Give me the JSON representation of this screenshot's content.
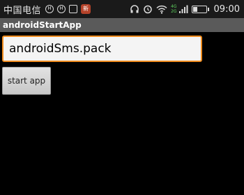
{
  "status_bar": {
    "carrier": "中国电信",
    "icons_left": [
      "hd-icon",
      "hd-icon",
      "image-notification-icon",
      "app-notification-icon"
    ],
    "app_badge_text": "新",
    "icons_right": [
      "headphones-icon",
      "alarm-icon",
      "wifi-icon",
      "signal-icon",
      "sim-icon",
      "battery-icon"
    ],
    "net_4g": "4G",
    "net_2g": "2G",
    "battery_level": 0.35,
    "time": "09:00"
  },
  "action_bar": {
    "title": "androidStartApp"
  },
  "main": {
    "package_input_value": "androidSms.pack",
    "start_button_label": "start app"
  },
  "colors": {
    "input_focus_border": "#f08c1e",
    "action_bar_bg": "#5a5a5a",
    "status_bar_bg": "#1a1a1a",
    "background": "#000000"
  }
}
